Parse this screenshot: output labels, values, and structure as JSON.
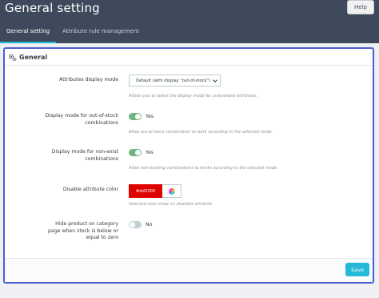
{
  "header": {
    "title": "General setting",
    "help_label": "Help"
  },
  "tabs": [
    {
      "label": "General setting",
      "active": true
    },
    {
      "label": "Attribute rule management",
      "active": false
    }
  ],
  "panel": {
    "icon": "cogs-icon",
    "title": "General",
    "fields": {
      "display_mode": {
        "label": "Attributes display mode",
        "value": "Default (with display \"out-of-stock\")",
        "help": "Allows you to select the display mode for unavailable attributes."
      },
      "out_of_stock": {
        "label": "Display mode for out-of-stock combinations",
        "enabled": true,
        "state_label": "Yes",
        "help": "Allow out-of-stock combination to work according to the selected mode."
      },
      "non_exist": {
        "label": "Display mode for non-exist combinations",
        "enabled": true,
        "state_label": "Yes",
        "help": "Allow non-existing combinations to works according to the selected mode."
      },
      "disable_color": {
        "label": "Disable attribute color",
        "value": "#dd0300",
        "help": "Selected color show on disabled attribute."
      },
      "hide_product": {
        "label": "Hide product on category page when stock is below or equal to zero",
        "enabled": false,
        "state_label": "No"
      }
    },
    "save_label": "Save"
  },
  "colors": {
    "header_bg": "#3e4a5c",
    "accent": "#25b9d7",
    "switch_on": "#70b580",
    "switch_off": "#c5cfd6",
    "panel_border": "#4a5fd4",
    "disable_color": "#dd0300"
  }
}
